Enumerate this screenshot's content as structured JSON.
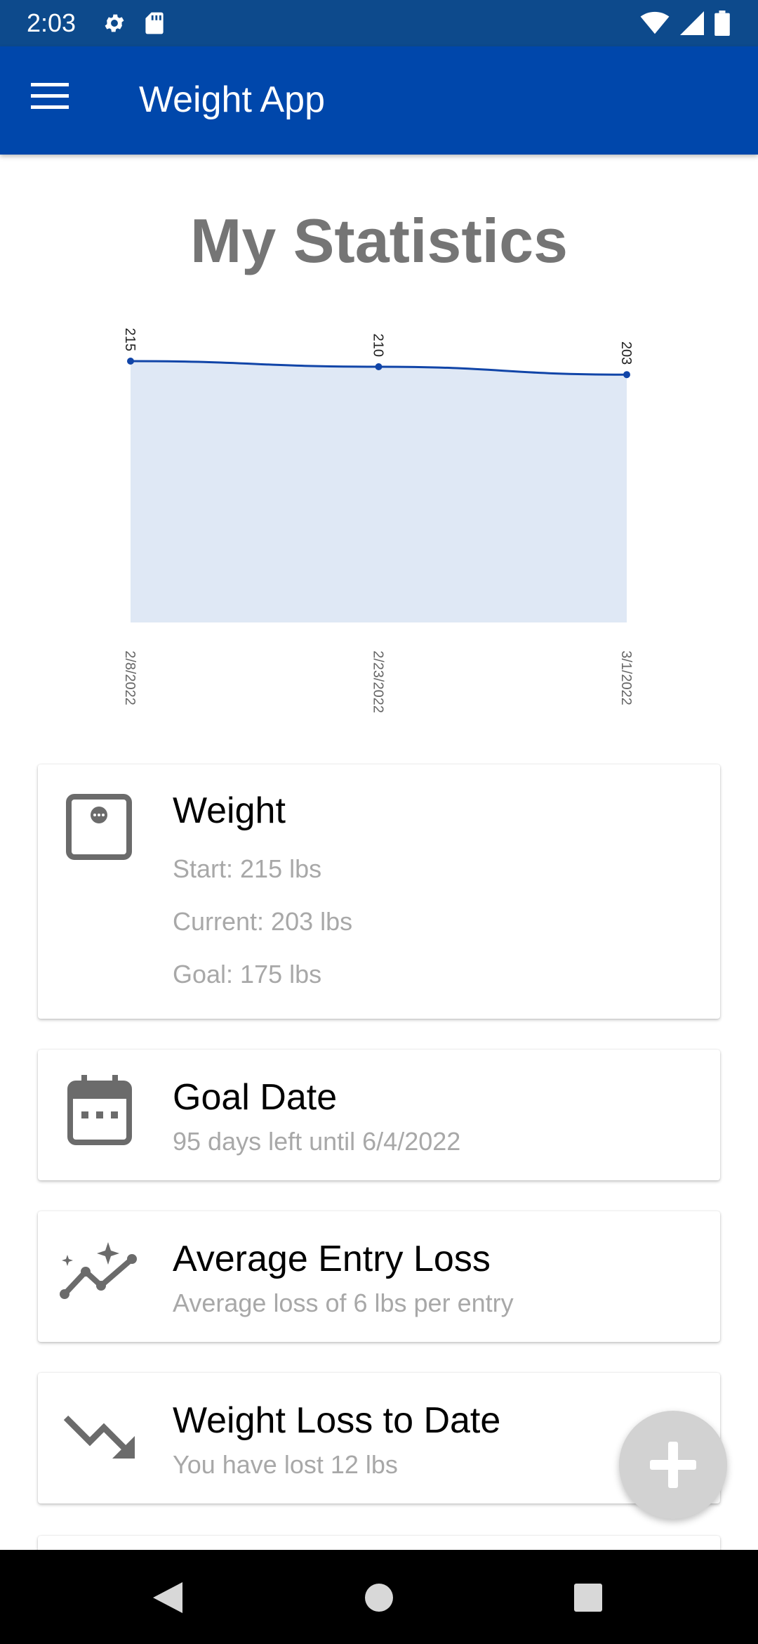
{
  "status_bar": {
    "time": "2:03",
    "left_icons": [
      "gear-icon",
      "sd-card-icon"
    ],
    "right_icons": [
      "wifi-icon",
      "signal-icon",
      "battery-icon"
    ]
  },
  "app_bar": {
    "title": "Weight App",
    "menu_icon": "hamburger-menu-icon",
    "color": "#0047ab"
  },
  "page": {
    "title": "My Statistics"
  },
  "chart_data": {
    "type": "area",
    "x": [
      "2/8/2022",
      "2/23/2022",
      "3/1/2022"
    ],
    "series": [
      {
        "values": [
          215,
          210,
          203
        ]
      }
    ],
    "data_labels": [
      "215",
      "210",
      "203"
    ],
    "ylim": [
      0,
      215
    ],
    "line_color": "#1145a8",
    "fill_color": "#dfe8f5",
    "grid": false,
    "legend": false
  },
  "cards": [
    {
      "icon": "scale-icon",
      "title": "Weight",
      "lines": [
        "Start: 215 lbs",
        "Current: 203 lbs",
        "Goal: 175 lbs"
      ]
    },
    {
      "icon": "calendar-icon",
      "title": "Goal Date",
      "lines": [
        "95 days left until 6/4/2022"
      ]
    },
    {
      "icon": "trend-sparkle-icon",
      "title": "Average Entry Loss",
      "lines": [
        "Average loss of 6 lbs per entry"
      ]
    },
    {
      "icon": "trending-down-icon",
      "title": "Weight Loss to Date",
      "lines": [
        "You have lost 12 lbs"
      ]
    }
  ],
  "fab": {
    "icon": "plus-icon"
  },
  "nav_bar": {
    "icons": [
      "back-icon",
      "home-icon",
      "recents-icon"
    ]
  }
}
